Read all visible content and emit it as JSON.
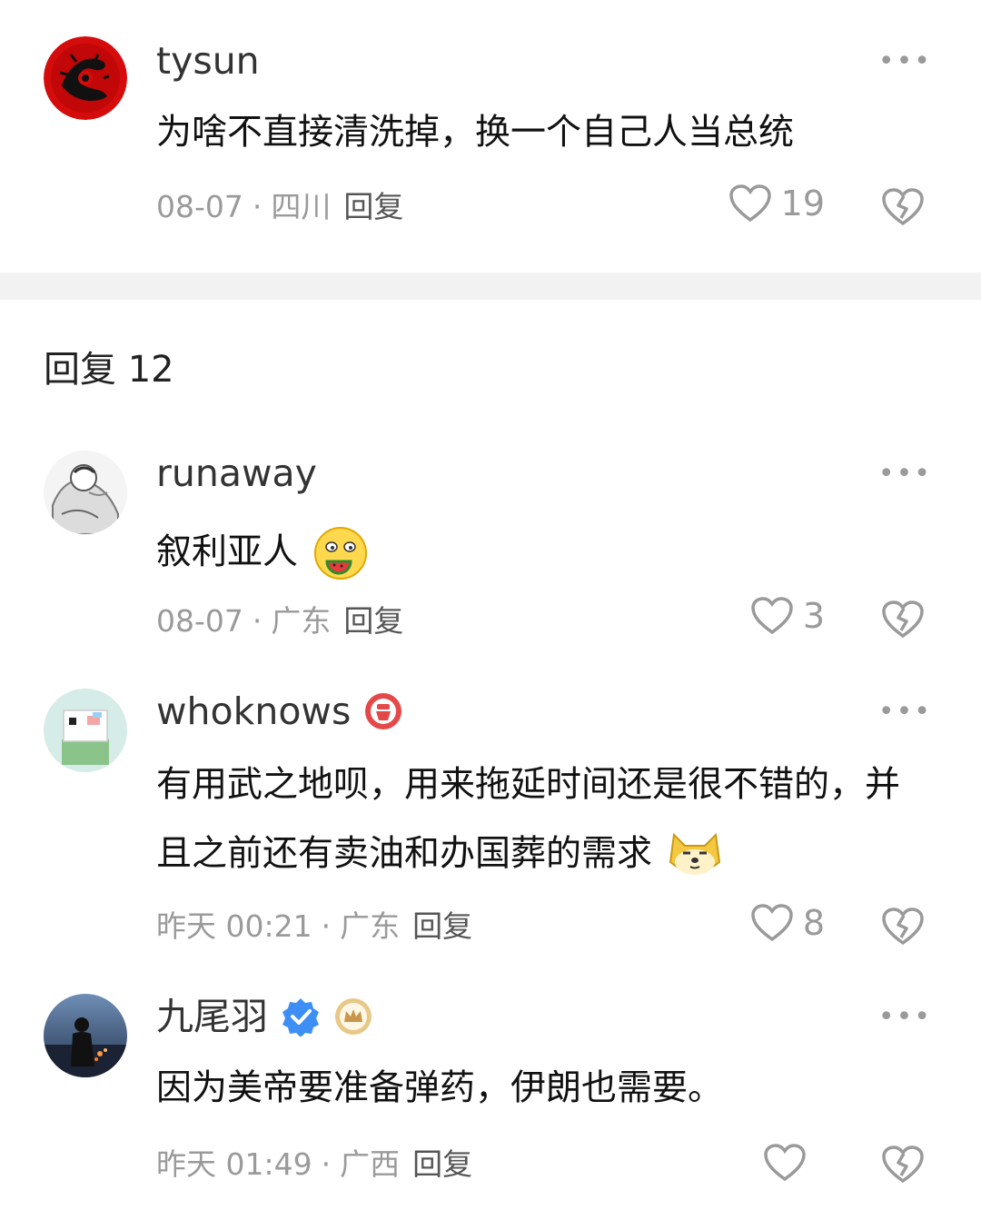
{
  "top_comment": {
    "username": "tysun",
    "text": "为啥不直接清洗掉，换一个自己人当总统",
    "date": "08-07",
    "location": "四川",
    "reply_label": "回复",
    "likes": "19",
    "avatar": "red-dragon-avatar-icon"
  },
  "replies_header": {
    "label": "回复 12"
  },
  "replies": [
    {
      "username": "runaway",
      "text": "叙利亚人",
      "emoji": "eating-watermelon-emoji-icon",
      "date": "08-07",
      "location": "广东",
      "reply_label": "回复",
      "likes": "3"
    },
    {
      "username": "whoknows",
      "badge": "red-badge-icon",
      "text": "有用武之地呗，用来拖延时间还是很不错的，并且之前还有卖油和办国葬的需求",
      "emoji": "shiba-dog-emoji-icon",
      "date": "昨天 00:21",
      "location": "广东",
      "reply_label": "回复",
      "likes": "8"
    },
    {
      "username": "九尾羽",
      "badges": [
        "verified-check-icon",
        "crown-badge-icon"
      ],
      "text": "因为美帝要准备弹药，伊朗也需要。",
      "date": "昨天 01:49",
      "location": "广西",
      "reply_label": "回复",
      "likes": ""
    }
  ],
  "colors": {
    "meta_gray": "#9a9a9a",
    "verified_blue": "#3d8ff5",
    "divider": "#f2f2f2"
  }
}
